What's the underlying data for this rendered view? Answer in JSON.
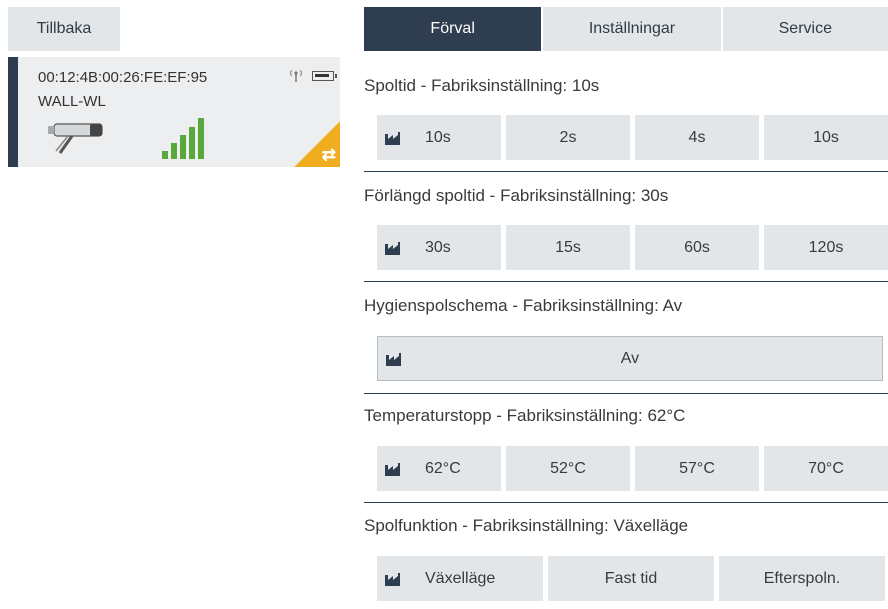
{
  "back_label": "Tillbaka",
  "device": {
    "mac": "00:12:4B:00:26:FE:EF:95",
    "name": "WALL-WL",
    "swap_symbol": "⇄",
    "accent_color": "#f0ad1f",
    "signal_color": "#5aa83b"
  },
  "tabs": [
    "Förval",
    "Inställningar",
    "Service"
  ],
  "sections": [
    {
      "title": "Spoltid - Fabriksinställning: 10s",
      "options": [
        "10s",
        "2s",
        "4s",
        "10s"
      ]
    },
    {
      "title": "Förlängd spoltid - Fabriksinställning: 30s",
      "options": [
        "30s",
        "15s",
        "60s",
        "120s"
      ]
    },
    {
      "title": "Hygienspolschema - Fabriksinställning: Av",
      "options": [
        "Av"
      ]
    },
    {
      "title": "Temperaturstopp - Fabriksinställning: 62°C",
      "options": [
        "62°C",
        "52°C",
        "57°C",
        "70°C"
      ]
    },
    {
      "title": "Spolfunktion - Fabriksinställning: Växelläge",
      "options": [
        "Växelläge",
        "Fast tid",
        "Efterspoln."
      ]
    }
  ],
  "icons": {
    "default_marker": "factory-icon",
    "device": "faucet-icon",
    "signal": "signal-strength-icon",
    "wireless": "antenna-icon",
    "battery": "battery-icon"
  },
  "colors": {
    "active_tab": "#2e3d4f",
    "button_bg": "#e3e6e9",
    "card_bg": "#eceef0"
  }
}
